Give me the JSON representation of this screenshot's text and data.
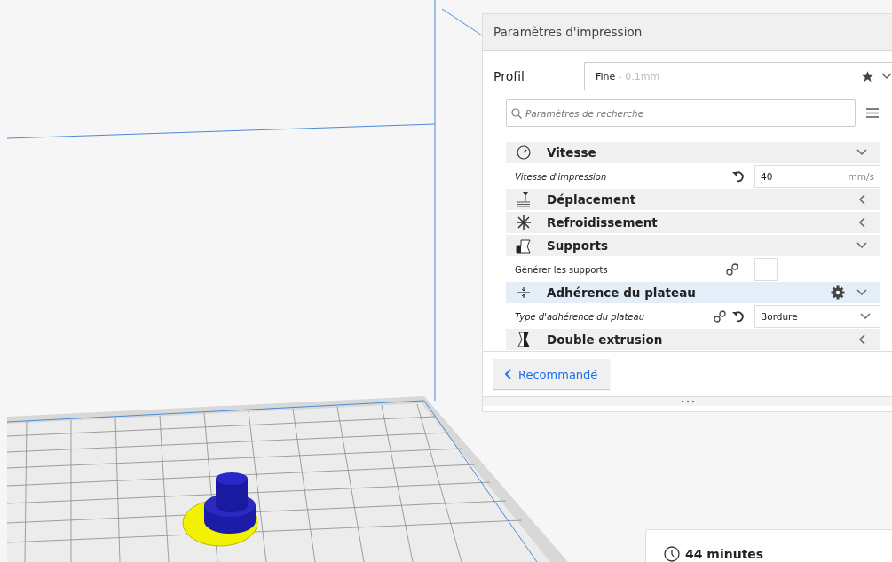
{
  "print_settings": {
    "title": "Paramètres d'impression",
    "profile": {
      "label": "Profil",
      "name": "Fine",
      "detail": " - 0.1mm"
    },
    "search": {
      "placeholder": "Paramètres de recherche"
    },
    "rows": [
      {
        "kind": "category",
        "title": "Vitesse",
        "expanded": true,
        "highlighted": false,
        "settings_button": false
      },
      {
        "kind": "setting",
        "label": "Vitesse d'impression",
        "modified": true,
        "linked": false,
        "resettable": true,
        "control": {
          "kind": "number",
          "value": "40",
          "unit": "mm/s"
        }
      },
      {
        "kind": "category",
        "title": "Déplacement",
        "expanded": false,
        "highlighted": false,
        "settings_button": false
      },
      {
        "kind": "category",
        "title": "Refroidissement",
        "expanded": false,
        "highlighted": false,
        "settings_button": false
      },
      {
        "kind": "category",
        "title": "Supports",
        "expanded": true,
        "highlighted": false,
        "settings_button": false
      },
      {
        "kind": "setting",
        "label": "Générer les supports",
        "modified": false,
        "linked": true,
        "resettable": false,
        "control": {
          "kind": "checkbox",
          "checked": false
        }
      },
      {
        "kind": "category",
        "title": "Adhérence du plateau",
        "expanded": true,
        "highlighted": true,
        "settings_button": true
      },
      {
        "kind": "setting",
        "label": "Type d'adhérence du plateau",
        "modified": true,
        "linked": true,
        "resettable": true,
        "control": {
          "kind": "dropdown",
          "value": "Bordure"
        }
      },
      {
        "kind": "category",
        "title": "Double extrusion",
        "expanded": false,
        "highlighted": false,
        "settings_button": false
      }
    ],
    "back_button": "Recommandé"
  },
  "estimate": {
    "time": "44 minutes"
  }
}
